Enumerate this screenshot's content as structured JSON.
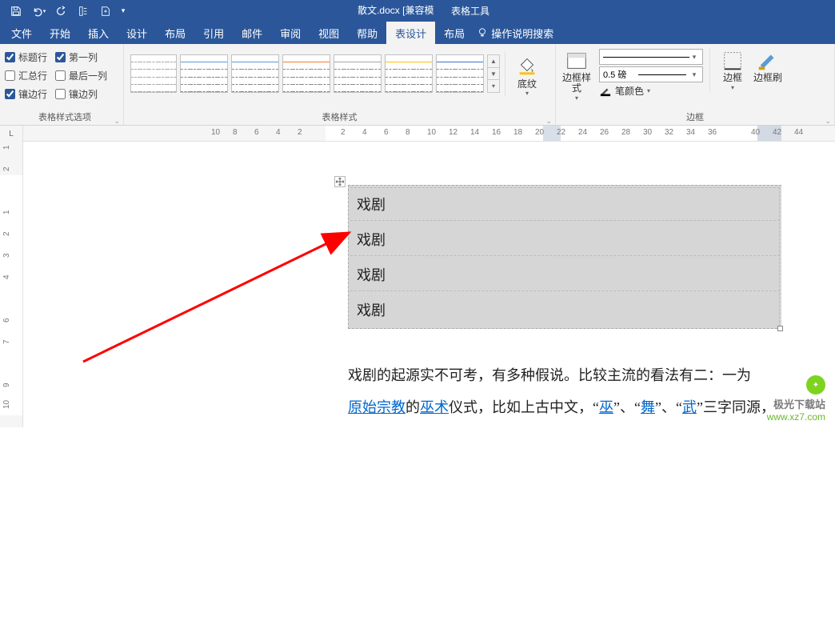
{
  "title": "散文.docx  [兼容模式]  -  Word",
  "context_tab": "表格工具",
  "qat": {
    "save": "保存",
    "undo": "撤销",
    "redo": "恢复",
    "touch": "触摸",
    "new": "新建",
    "more": "自定义"
  },
  "tabs": {
    "file": "文件",
    "home": "开始",
    "insert": "插入",
    "design": "设计",
    "layout": "布局",
    "references": "引用",
    "mail": "邮件",
    "review": "审阅",
    "view": "视图",
    "help": "帮助",
    "table_design": "表设计",
    "table_layout": "布局",
    "tell_me": "操作说明搜索"
  },
  "groups": {
    "style_options": {
      "title": "表格样式选项",
      "header_row": "标题行",
      "first_col": "第一列",
      "total_row": "汇总行",
      "last_col": "最后一列",
      "banded_row": "镶边行",
      "banded_col": "镶边列",
      "checked": {
        "header_row": true,
        "first_col": true,
        "total_row": false,
        "last_col": false,
        "banded_row": true,
        "banded_col": false
      }
    },
    "table_styles": {
      "title": "表格样式",
      "shading": "底纹"
    },
    "borders": {
      "title": "边框",
      "border_styles": "边框样式",
      "weight_label": "0.5 磅",
      "pen_color": "笔颜色",
      "borders_btn": "边框",
      "border_brush": "边框刷"
    }
  },
  "ruler": {
    "corner": "L",
    "top_numbers": [
      "10",
      "8",
      "6",
      "4",
      "2",
      "",
      "2",
      "4",
      "6",
      "8",
      "10",
      "12",
      "14",
      "16",
      "18",
      "20",
      "22",
      "24",
      "26",
      "28",
      "30",
      "32",
      "34",
      "36",
      "",
      "40",
      "42",
      "44"
    ],
    "left_numbers": [
      "1",
      "2",
      "",
      "1",
      "2",
      "3",
      "4",
      "",
      "6",
      "7",
      "",
      "9",
      "10"
    ]
  },
  "document": {
    "cells": [
      "戏剧",
      "戏剧",
      "戏剧",
      "戏剧"
    ],
    "para1_prefix": "戏剧的起源实不可考，有多种假说。比较主流的看法有二：一为",
    "link1": "原始宗教",
    "mid1": "的",
    "link2": "巫术",
    "mid2": "仪式，比如上古中文，“",
    "link3": "巫",
    "mid3": "”、“",
    "link4": "舞",
    "mid4": "”、“",
    "link5": "武",
    "tail": "”三字同源，"
  },
  "watermark": {
    "name": "极光下载站",
    "url": "www.xz7.com"
  }
}
